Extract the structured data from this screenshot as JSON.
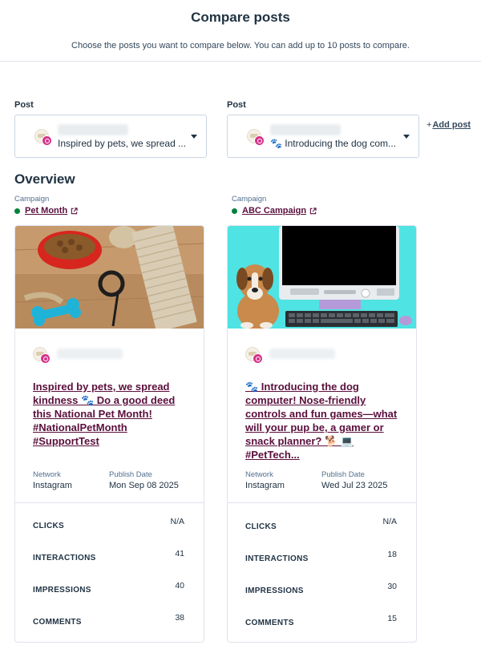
{
  "header": {
    "title": "Compare posts",
    "subtitle": "Choose the posts you want to compare below. You can add up to 10 posts to compare."
  },
  "selectors": [
    {
      "label": "Post",
      "text": "Inspired by pets, we spread ..."
    },
    {
      "label": "Post",
      "text": "🐾 Introducing the dog com..."
    }
  ],
  "add_post": {
    "plus": "+",
    "label": "Add post"
  },
  "overview": {
    "title": "Overview",
    "campaign_label": "Campaign",
    "status_color": "#00823a",
    "link_color": "#5a0f3c"
  },
  "posts": [
    {
      "campaign": "Pet Month",
      "text": "Inspired by pets, we spread kindness 🐾 Do a good deed this National Pet Month! #NationalPetMonth #SupportTest",
      "network_label": "Network",
      "network": "Instagram",
      "publish_label": "Publish Date",
      "publish_date": "Mon Sep 08 2025",
      "metrics": [
        {
          "name": "CLICKS",
          "value": "N/A"
        },
        {
          "name": "INTERACTIONS",
          "value": "41"
        },
        {
          "name": "IMPRESSIONS",
          "value": "40"
        },
        {
          "name": "COMMENTS",
          "value": "38"
        }
      ]
    },
    {
      "campaign": "ABC Campaign",
      "text": "🐾 Introducing the dog computer! Nose-friendly controls and fun games—what will your pup be, a gamer or snack planner? 🐕 💻 #PetTech...",
      "network_label": "Network",
      "network": "Instagram",
      "publish_label": "Publish Date",
      "publish_date": "Wed Jul 23 2025",
      "metrics": [
        {
          "name": "CLICKS",
          "value": "N/A"
        },
        {
          "name": "INTERACTIONS",
          "value": "18"
        },
        {
          "name": "IMPRESSIONS",
          "value": "30"
        },
        {
          "name": "COMMENTS",
          "value": "15"
        }
      ]
    }
  ]
}
